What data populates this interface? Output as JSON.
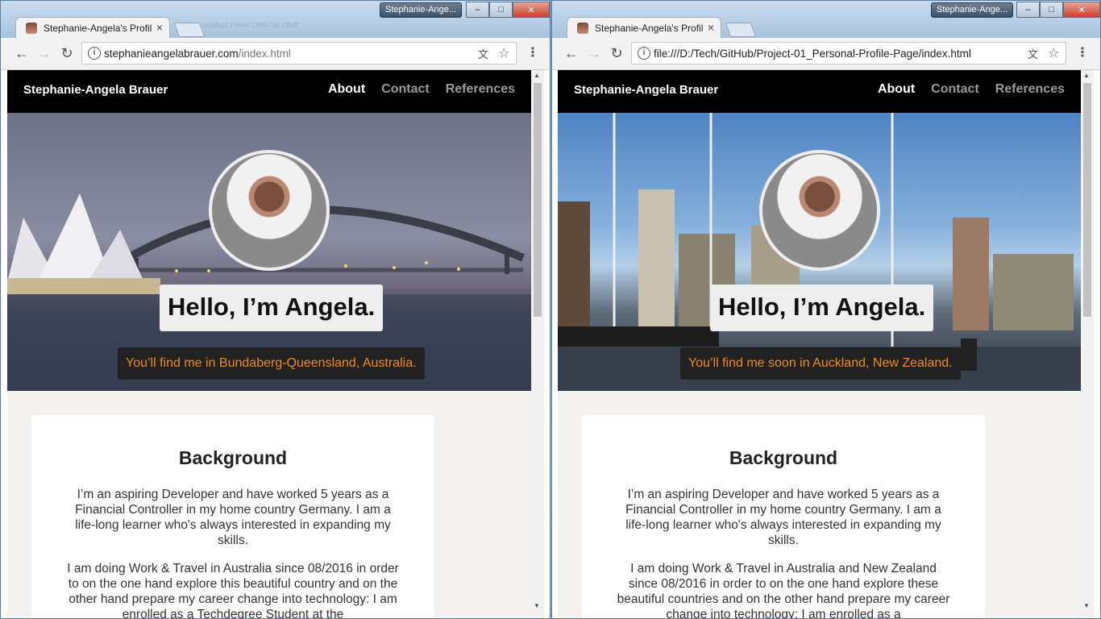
{
  "taskbar": {
    "left_label": "Stephanie-Ange...",
    "right_label": "Stephanie-Ange..."
  },
  "left": {
    "tab_title": "Stephanie-Angela's Profil",
    "ghost_tab": "localhost:1 Sven 1366x768 1BWF",
    "url_host": "stephanieangelabrauer.com",
    "url_path": "/index.html",
    "site": {
      "brand": "Stephanie-Angela Brauer",
      "nav": [
        "About",
        "Contact",
        "References"
      ],
      "hello": "Hello, I’m Angela.",
      "location": "You’ll find me in Bundaberg-Queensland, Australia.",
      "section_title": "Background",
      "para1": "I’m an aspiring Developer and have worked 5 years as a Financial Controller in my home country Germany. I am a life-long learner who's always interested in expanding my skills.",
      "para2": "I am doing Work & Travel in Australia since 08/2016 in order to on the one hand explore this beautiful country and on the other hand prepare my career change into technology: I am enrolled as a Techdegree Student at the"
    }
  },
  "right": {
    "tab_title": "Stephanie-Angela's Profil",
    "url_host": "file:///D:/Tech/GitHub/Project-01_Personal-Profile-Page/index.html",
    "url_path": "",
    "site": {
      "brand": "Stephanie-Angela Brauer",
      "nav": [
        "About",
        "Contact",
        "References"
      ],
      "hello": "Hello, I’m Angela.",
      "location": "You’ll find me soon in Auckland, New Zealand.",
      "section_title": "Background",
      "para1": "I’m an aspiring Developer and have worked 5 years as a Financial Controller in my home country Germany. I am a life-long learner who's always interested in expanding my skills.",
      "para2": "I am doing Work & Travel in Australia and New Zealand since 08/2016 in order to on the one hand explore these beautiful countries and on the other hand prepare my career change into technology: I am enrolled as a"
    }
  },
  "icons": {
    "back": "←",
    "forward": "→",
    "reload": "↻",
    "info": "i",
    "translate": "文",
    "star": "☆",
    "menu": "⋮",
    "close_tab": "×",
    "minimize": "–",
    "maximize": "□",
    "close_window": "✕"
  }
}
